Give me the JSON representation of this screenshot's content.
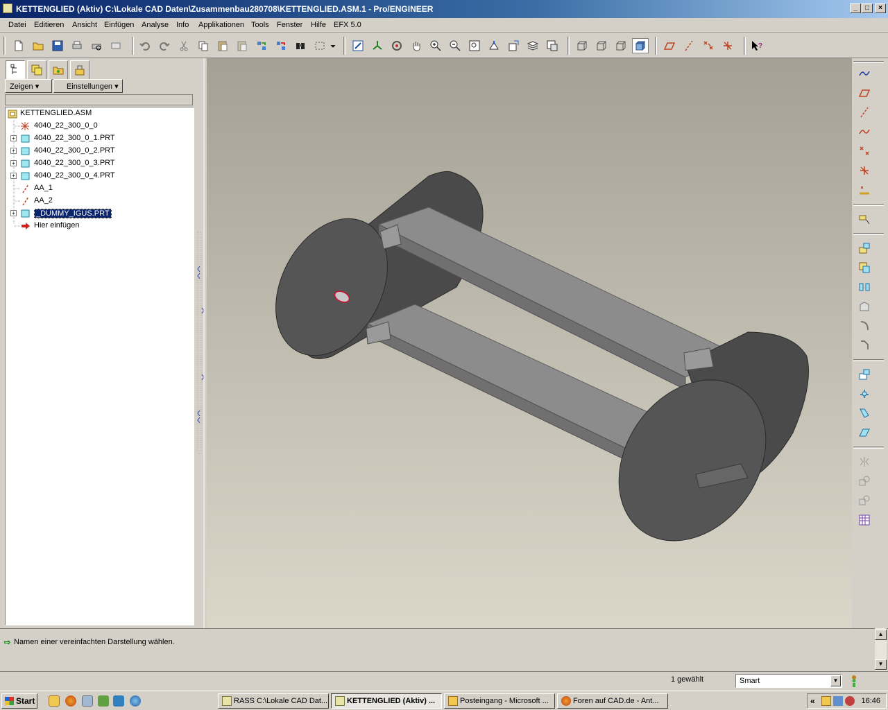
{
  "window": {
    "title": "KETTENGLIED (Aktiv) C:\\Lokale CAD Daten\\Zusammenbau280708\\KETTENGLIED.ASM.1 - Pro/ENGINEER",
    "minimize": "_",
    "maximize": "□",
    "close": "×"
  },
  "menu": {
    "items": [
      "Datei",
      "Editieren",
      "Ansicht",
      "Einfügen",
      "Analyse",
      "Info",
      "Applikationen",
      "Tools",
      "Fenster",
      "Hilfe",
      "EFX 5.0"
    ]
  },
  "toolbar": {
    "icons": [
      "new-file-icon",
      "open-folder-icon",
      "save-icon",
      "print-icon",
      "print-preview-icon",
      "mail-icon",
      "undo-icon",
      "redo-icon",
      "cut-icon",
      "copy-icon",
      "paste-icon",
      "paste-special-icon",
      "regenerate-icon",
      "regen-manager-icon",
      "find-icon",
      "select-box-icon",
      "repaint-icon",
      "spin-center-icon",
      "orient-icon",
      "pan-icon",
      "zoom-in-icon",
      "zoom-out-icon",
      "refit-icon",
      "reorient-icon",
      "view-manager-icon",
      "layers-icon",
      "saved-views-icon",
      "wireframe-icon",
      "hidden-line-icon",
      "no-hidden-icon",
      "shading-icon",
      "datum-planes-icon",
      "datum-axes-icon",
      "datum-points-icon",
      "coord-systems-icon",
      "context-help-icon"
    ]
  },
  "left_panel": {
    "tabs": [
      "model-tree-icon",
      "layers-tab-icon",
      "folder-browser-icon",
      "favorites-icon"
    ],
    "show_button": "Zeigen",
    "settings_button": "Einstellungen",
    "tree": [
      {
        "label": "KETTENGLIED.ASM",
        "icon": "assembly-icon",
        "expandable": false,
        "selected": false
      },
      {
        "label": "4040_22_300_0_0",
        "icon": "coord-system-icon",
        "expandable": false,
        "selected": false
      },
      {
        "label": "4040_22_300_0_1.PRT",
        "icon": "part-icon",
        "expandable": true,
        "selected": false
      },
      {
        "label": "4040_22_300_0_2.PRT",
        "icon": "part-icon",
        "expandable": true,
        "selected": false
      },
      {
        "label": "4040_22_300_0_3.PRT",
        "icon": "part-icon",
        "expandable": true,
        "selected": false
      },
      {
        "label": "4040_22_300_0_4.PRT",
        "icon": "part-icon",
        "expandable": true,
        "selected": false
      },
      {
        "label": "AA_1",
        "icon": "axis-icon",
        "expandable": false,
        "selected": false
      },
      {
        "label": "AA_2",
        "icon": "axis-icon",
        "expandable": false,
        "selected": false
      },
      {
        "label": "_DUMMY_IGUS.PRT",
        "icon": "part-icon",
        "expandable": true,
        "selected": true
      },
      {
        "label": "Hier einfügen",
        "icon": "insert-here-icon",
        "expandable": false,
        "selected": false
      }
    ]
  },
  "right_toolbar": {
    "icons": [
      "sketch-tool-icon",
      "datum-plane-icon",
      "datum-axis-icon",
      "datum-curve-icon",
      "datum-point-icon",
      "coord-system-create-icon",
      "analysis-feature-icon",
      "annotation-icon",
      "component-place-icon",
      "component-create-icon",
      "mirror-component-icon",
      "restructure-icon",
      "round-icon",
      "chamfer-icon",
      "hole-icon",
      "shell-icon",
      "draft-icon",
      "rib-icon",
      "mirror-icon",
      "pattern-icon",
      "merge-icon",
      "table-icon"
    ]
  },
  "message": {
    "text": "Namen einer vereinfachten Darstellung wählen."
  },
  "status": {
    "selected_count": "1 gewählt",
    "filter_value": "Smart"
  },
  "taskbar": {
    "start_label": "Start",
    "buttons": [
      {
        "label": "RASS C:\\Lokale CAD Dat...",
        "active": false
      },
      {
        "label": "KETTENGLIED (Aktiv) ...",
        "active": true
      },
      {
        "label": "Posteingang - Microsoft ...",
        "active": false
      },
      {
        "label": "Foren auf CAD.de - Ant...",
        "active": false
      }
    ],
    "tray_chevron": "«",
    "clock": "16:46"
  }
}
